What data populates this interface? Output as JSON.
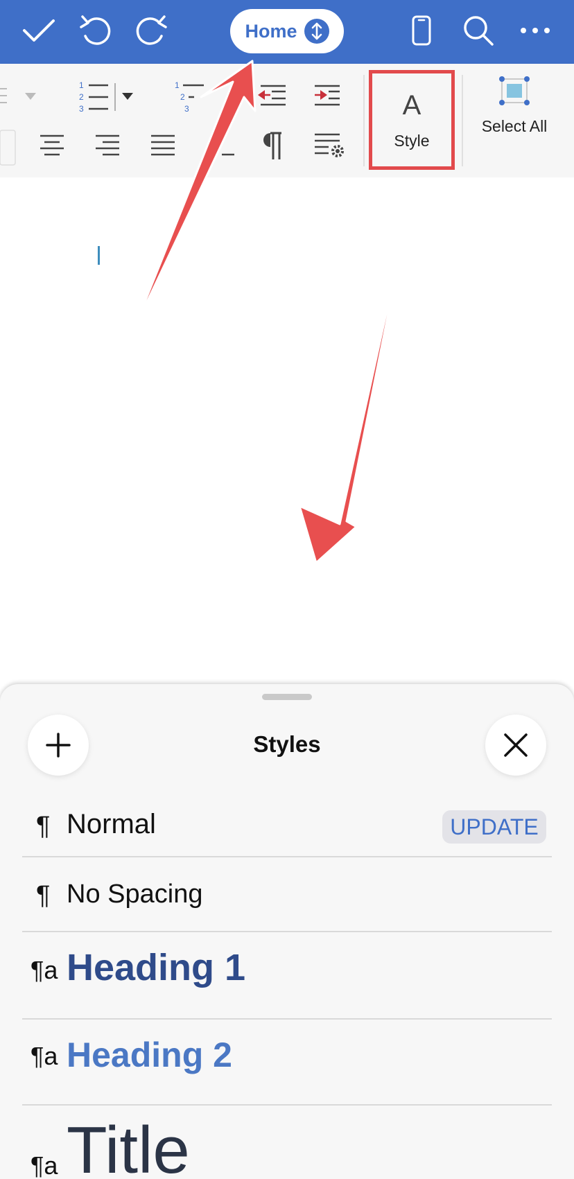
{
  "toolbar": {
    "home_label": "Home",
    "icons": [
      "checkmark-icon",
      "undo-icon",
      "redo-icon",
      "phone-view-icon",
      "search-icon",
      "more-icon"
    ]
  },
  "ribbon": {
    "style_glyph": "A",
    "style_label": "Style",
    "select_all_label": "Select All"
  },
  "styles_panel": {
    "title": "Styles",
    "items": [
      {
        "name": "Normal",
        "marker": "¶",
        "action": "UPDATE"
      },
      {
        "name": "No Spacing",
        "marker": "¶"
      },
      {
        "name": "Heading 1",
        "marker": "¶a"
      },
      {
        "name": "Heading 2",
        "marker": "¶a"
      },
      {
        "name": "Title",
        "marker": "¶a"
      }
    ]
  },
  "colors": {
    "accent": "#3f6fc8",
    "highlight": "#e24a4c",
    "heading1": "#2f4b8a",
    "heading2": "#4b78c4",
    "title": "#2b3446"
  }
}
